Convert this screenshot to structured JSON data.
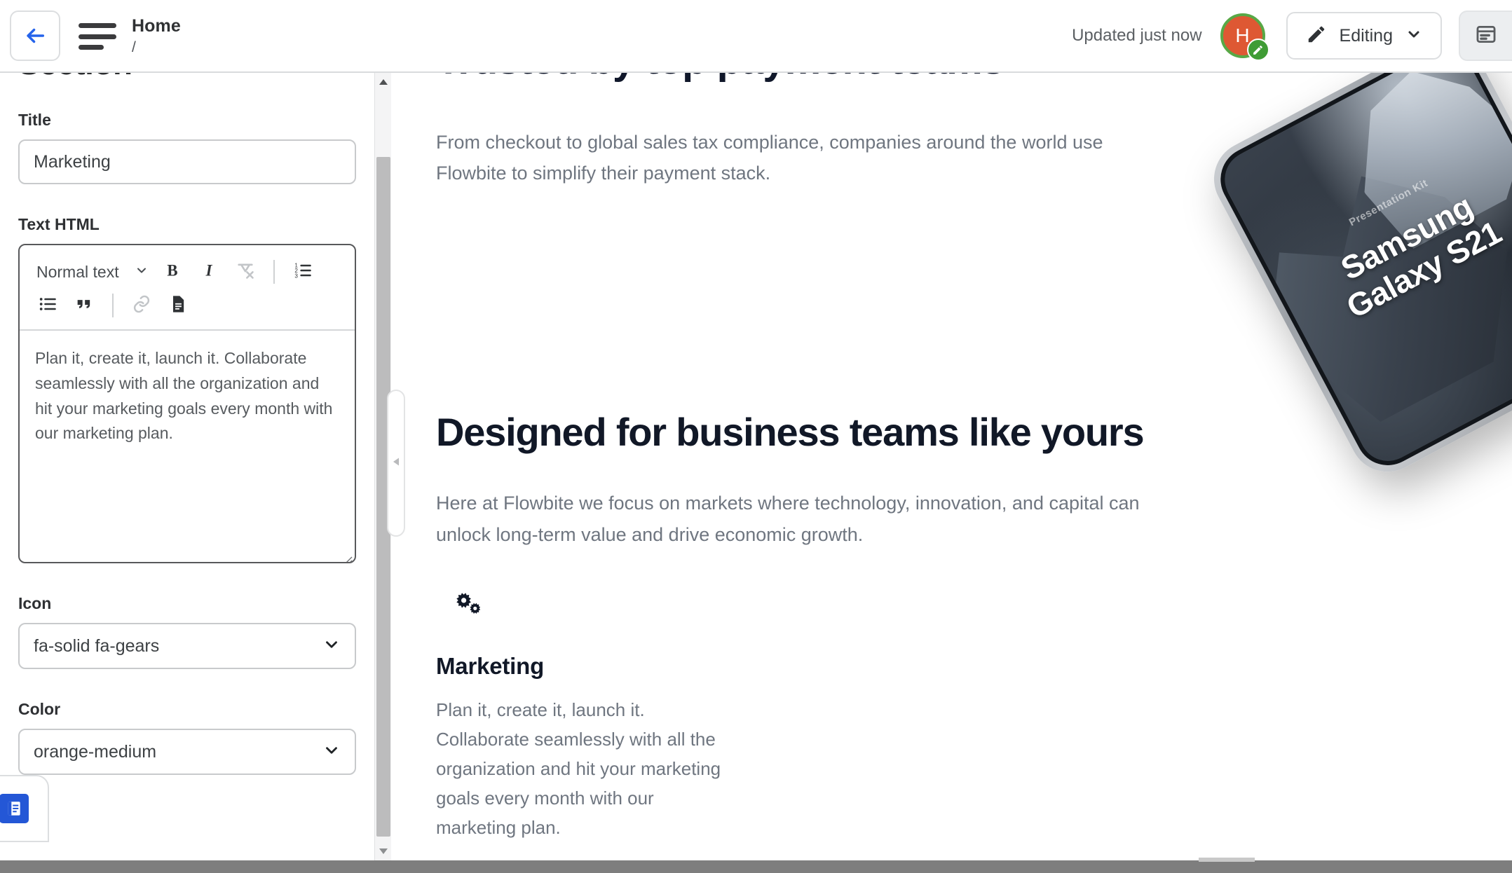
{
  "topbar": {
    "back_icon": "arrow-left-icon",
    "menu_icon": "hamburger-menu-icon",
    "breadcrumb_title": "Home",
    "breadcrumb_path": "/",
    "updated_status": "Updated just now",
    "avatar_initial": "H",
    "avatar_badge_icon": "pencil-badge-icon",
    "avatar_bg_color": "#de5833",
    "avatar_ring_color": "#58a846",
    "editing_label": "Editing",
    "editing_icon": "pencil-icon",
    "editing_chevron_icon": "chevron-down-icon",
    "panel_toggle_icon": "panel-right-icon"
  },
  "editor_panel": {
    "section_heading": "Section",
    "title_label": "Title",
    "title_value": "Marketing",
    "title_placeholder": "Title",
    "text_html_label": "Text HTML",
    "rich_text": {
      "style_dropdown_value": "Normal text",
      "toolbar_row1": [
        {
          "name": "bold-icon",
          "label": "B",
          "disabled": false
        },
        {
          "name": "italic-icon",
          "label": "I",
          "disabled": false
        },
        {
          "name": "clear-formatting-icon",
          "label": "Clear formatting",
          "disabled": true
        },
        {
          "name": "ordered-list-icon",
          "label": "Numbered list",
          "disabled": false
        }
      ],
      "toolbar_row2": [
        {
          "name": "bullet-list-icon",
          "label": "Bullet list",
          "disabled": false
        },
        {
          "name": "blockquote-icon",
          "label": "Quote",
          "disabled": false
        },
        {
          "name": "link-icon",
          "label": "Link",
          "disabled": true
        },
        {
          "name": "document-icon",
          "label": "Document",
          "disabled": false
        }
      ],
      "content": "Plan it, create it, launch it. Collaborate seamlessly with all the organization and hit your marketing goals every month with our marketing plan."
    },
    "icon_label": "Icon",
    "icon_value": "fa-solid fa-gears",
    "color_label": "Color",
    "color_value": "orange-medium",
    "dropdown_chevron_icon": "chevron-down-icon",
    "scrollbar_up_icon": "scroll-up-arrow-icon",
    "scrollbar_down_icon": "scroll-down-arrow-icon",
    "collapse_handle_icon": "chevron-left-icon",
    "doc_fab_icon": "document-panel-icon",
    "doc_fab_color": "#2457d6"
  },
  "canvas": {
    "clipped_heading": "Trusted by top payment teams",
    "hero_paragraph": "From checkout to global sales tax compliance, companies around the world use Flowbite to simplify their payment stack.",
    "phone": {
      "kit_label": "Presentation Kit",
      "device_line1": "Samsung",
      "device_line2": "Galaxy S21"
    },
    "section_heading": "Designed for business teams like yours",
    "section_paragraph": "Here at Flowbite we focus on markets where technology, innovation, and capital can unlock long-term value and drive economic growth.",
    "feature": {
      "icon": "gears-icon",
      "title": "Marketing",
      "description": "Plan it, create it, launch it. Collaborate seamlessly with all the organization and hit your marketing goals every month with our marketing plan."
    }
  }
}
